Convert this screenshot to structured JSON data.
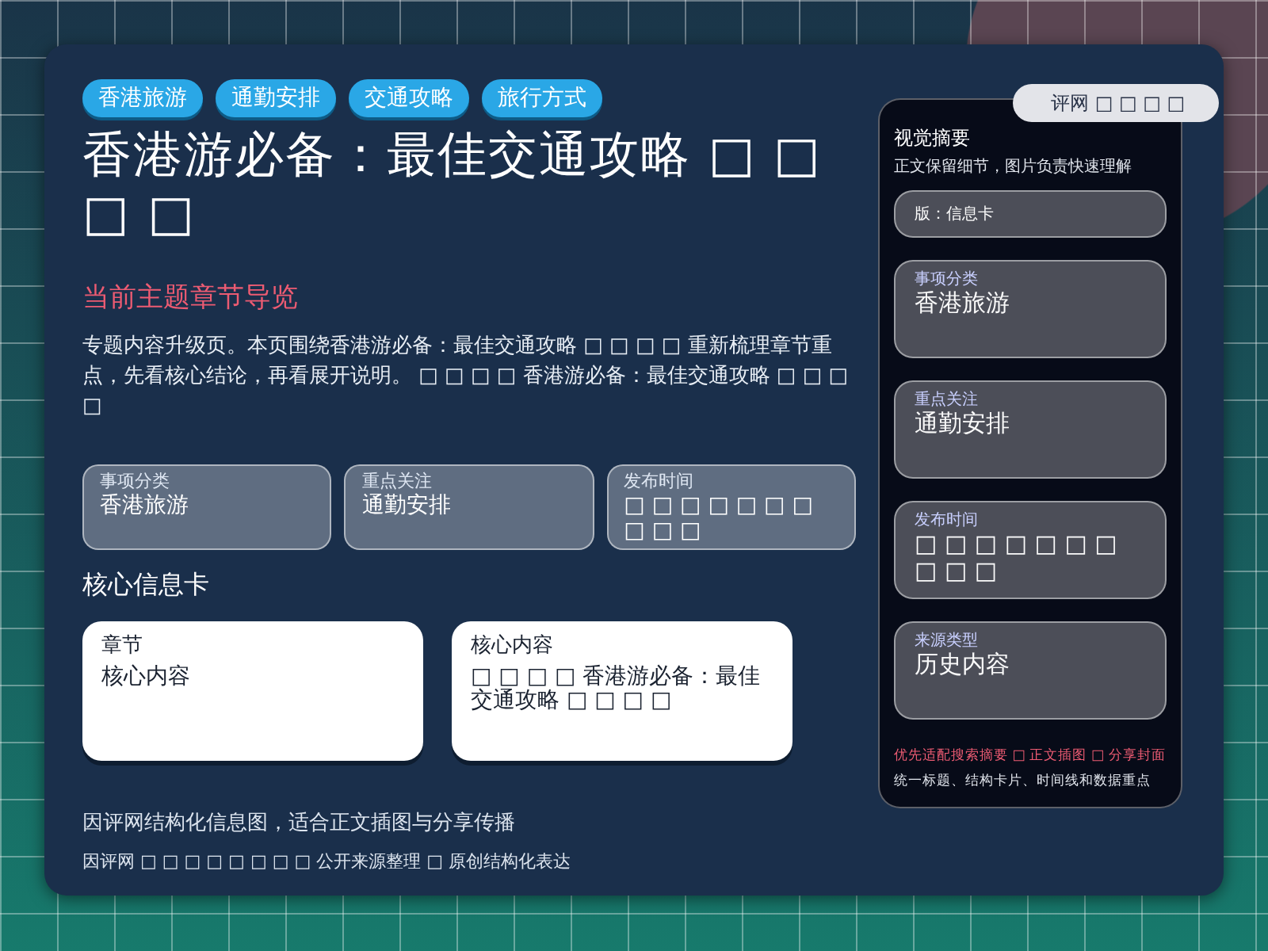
{
  "tags": [
    "香港旅游",
    "通勤安排",
    "交通攻略",
    "旅行方式"
  ],
  "title": "香港游必备：最佳交通攻略 □ □ □ □",
  "section_heading": "当前主题章节导览",
  "intro": "专题内容升级页。本页围绕香港游必备：最佳交通攻略 □ □ □ □ 重新梳理章节重点，先看核心结论，再看展开说明。 □ □ □ □ 香港游必备：最佳交通攻略 □ □ □ □",
  "facts": [
    {
      "label": "事项分类",
      "value": "香港旅游"
    },
    {
      "label": "重点关注",
      "value": "通勤安排"
    },
    {
      "label": "发布时间",
      "value": "□ □ □ □ □ □ □ □ □ □"
    }
  ],
  "core_heading": "核心信息卡",
  "core_cards": [
    {
      "label": "章节",
      "value": "核心内容"
    },
    {
      "label": "核心内容",
      "value": "□ □ □ □ 香港游必备：最佳交通攻略 □ □ □ □"
    }
  ],
  "footer": {
    "caption": "因评网结构化信息图，适合正文插图与分享传播",
    "meta": "因评网 □ □ □ □ □ □ □ □ 公开来源整理 □ 原创结构化表达"
  },
  "side_panel": {
    "badge": "评网 □ □ □ □",
    "title": "视觉摘要",
    "subtitle": "正文保留细节，图片负责快速理解",
    "cards": [
      {
        "kind": "strip",
        "value": "版：信息卡"
      },
      {
        "kind": "field",
        "label": "事项分类",
        "value": "香港旅游"
      },
      {
        "kind": "field",
        "label": "重点关注",
        "value": "通勤安排"
      },
      {
        "kind": "field",
        "label": "发布时间",
        "value": "□ □ □ □ □ □ □ □ □ □"
      },
      {
        "kind": "field",
        "label": "来源类型",
        "value": "历史内容"
      }
    ],
    "highlight": "优先适配搜索摘要 □ 正文插图 □ 分享封面",
    "note": "统一标题、结构卡片、时间线和数据重点"
  }
}
